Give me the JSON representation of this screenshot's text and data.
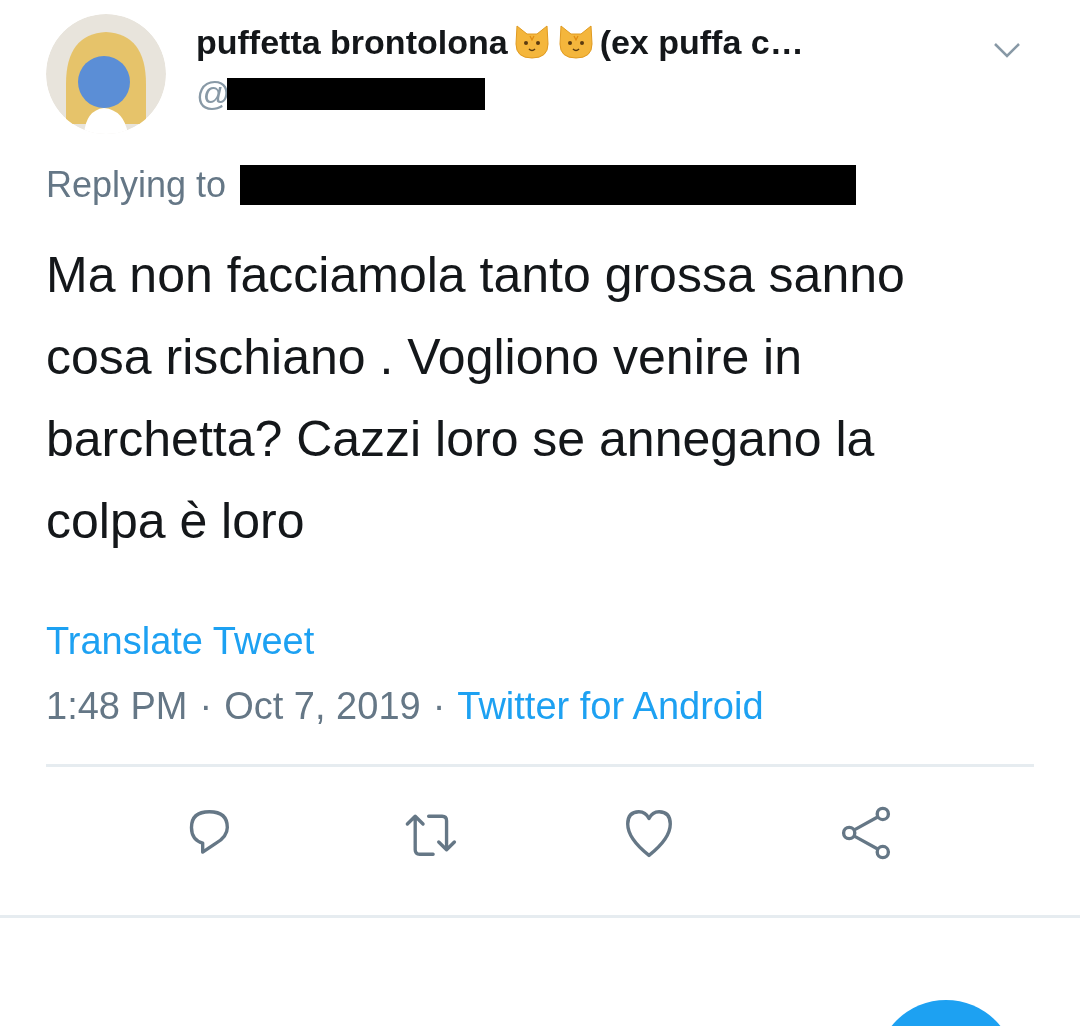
{
  "author": {
    "name": "puffetta brontolona",
    "name_suffix": "(ex puffa c…",
    "handle_prefix": "@"
  },
  "reply": {
    "label": "Replying to"
  },
  "tweet": {
    "text": "Ma non facciamola tanto grossa sanno cosa rischiano . Vogliono venire in barchetta? Cazzi loro se annegano la colpa è loro",
    "translate": "Translate Tweet",
    "time": "1:48 PM",
    "separator_1": "·",
    "date": "Oct 7, 2019",
    "separator_2": "·",
    "source": "Twitter for Android"
  }
}
